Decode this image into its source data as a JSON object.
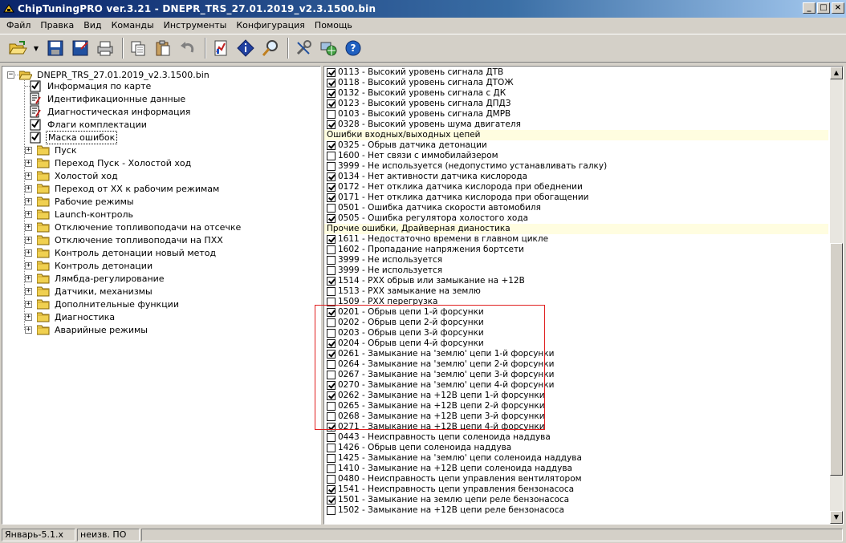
{
  "window": {
    "title": "ChipTuningPRO ver.3.21 - DNEPR_TRS_27.01.2019_v2.3.1500.bin",
    "buttons": {
      "minimize": "_",
      "maximize": "□",
      "close": "×"
    }
  },
  "menu": [
    "Файл",
    "Правка",
    "Вид",
    "Команды",
    "Инструменты",
    "Конфигурация",
    "Помощь"
  ],
  "toolbar": {
    "icons": [
      "open-folder-icon",
      "save-icon",
      "save-as-icon",
      "print-icon",
      "copy-icon",
      "paste-icon",
      "undo-icon",
      "chart-icon",
      "info-icon",
      "search-icon",
      "tools-icon",
      "network-icon",
      "help-icon"
    ]
  },
  "tree": {
    "root": "DNEPR_TRS_27.01.2019_v2.3.1500.bin",
    "docs": [
      {
        "label": "Информация по карте",
        "icon": "checklist"
      },
      {
        "label": "Идентификационные данные",
        "icon": "edit-doc"
      },
      {
        "label": "Диагностическая информация",
        "icon": "edit-doc"
      },
      {
        "label": "Флаги комплектации",
        "icon": "checklist"
      },
      {
        "label": "Маска ошибок",
        "icon": "checklist",
        "selected": true
      }
    ],
    "folders": [
      "Пуск",
      "Переход Пуск - Холостой ход",
      "Холостой ход",
      "Переход от ХХ к рабочим режимам",
      "Рабочие режимы",
      "Launch-контроль",
      "Отключение топливоподачи на отсечке",
      "Отключение топливоподачи на ПХХ",
      "Контроль детонации новый метод",
      "Контроль детонации",
      "Лямбда-регулирование",
      "Датчики, механизмы",
      "Дополнительные функции",
      "Диагностика",
      "Аварийные режимы"
    ]
  },
  "error_list": [
    {
      "text": "0113 - Высокий уровень сигнала ДТВ",
      "checked": true
    },
    {
      "text": "0118 - Высокий уровень сигнала ДТОЖ",
      "checked": true
    },
    {
      "text": "0132 - Высокий уровень сигнала с ДК",
      "checked": true
    },
    {
      "text": "0123 - Высокий уровень сигнала ДПДЗ",
      "checked": true
    },
    {
      "text": "0103 - Высокий уровень сигнала ДМРВ",
      "checked": false
    },
    {
      "text": "0328 - Высокий уровень шума двигателя",
      "checked": true
    },
    {
      "header": "Ошибки входных/выходных цепей"
    },
    {
      "text": "0325 - Обрыв датчика детонации",
      "checked": true
    },
    {
      "text": "1600 - Нет связи с иммобилайзером",
      "checked": false
    },
    {
      "text": "3999 - Не используется (недопустимо устанавливать галку)",
      "checked": false
    },
    {
      "text": "0134 - Нет активности датчика кислорода",
      "checked": true
    },
    {
      "text": "0172 - Нет отклика датчика кислорода при обеднении",
      "checked": true
    },
    {
      "text": "0171 - Нет отклика датчика кислорода при обогащении",
      "checked": true
    },
    {
      "text": "0501 - Ошибка датчика скорости автомобиля",
      "checked": false
    },
    {
      "text": "0505 - Ошибка регулятора холостого хода",
      "checked": true
    },
    {
      "header": "Прочие ошибки, Драйверная дианостика"
    },
    {
      "text": "1611 - Недостаточно времени в главном цикле",
      "checked": true
    },
    {
      "text": "1602 - Пропадание напряжения бортсети",
      "checked": false
    },
    {
      "text": "3999 - Не используется",
      "checked": false
    },
    {
      "text": "3999 - Не используется",
      "checked": false
    },
    {
      "text": "1514 - РХХ обрыв или замыкание на +12В",
      "checked": true
    },
    {
      "text": "1513 - РХХ замыкание на землю",
      "checked": false
    },
    {
      "text": "1509 - РХХ перегрузка",
      "checked": false
    },
    {
      "text": "0201 - Обрыв цепи 1-й форсунки",
      "checked": true
    },
    {
      "text": "0202 - Обрыв цепи 2-й форсунки",
      "checked": false
    },
    {
      "text": "0203 - Обрыв цепи 3-й форсунки",
      "checked": false
    },
    {
      "text": "0204 - Обрыв цепи 4-й форсунки",
      "checked": true
    },
    {
      "text": "0261 - Замыкание на 'землю' цепи 1-й форсунки",
      "checked": true
    },
    {
      "text": "0264 - Замыкание на 'землю' цепи 2-й форсунки",
      "checked": false
    },
    {
      "text": "0267 - Замыкание на 'землю' цепи 3-й форсунки",
      "checked": false
    },
    {
      "text": "0270 - Замыкание на 'землю' цепи 4-й форсунки",
      "checked": true
    },
    {
      "text": "0262 - Замыкание на +12В цепи 1-й форсунки",
      "checked": true
    },
    {
      "text": "0265 - Замыкание на +12В цепи 2-й форсунки",
      "checked": false
    },
    {
      "text": "0268 - Замыкание на +12В цепи 3-й форсунки",
      "checked": false
    },
    {
      "text": "0271 - Замыкание на +12В цепи 4-й форсунки",
      "checked": true
    },
    {
      "text": "0443 - Неисправность цепи соленоида наддува",
      "checked": false
    },
    {
      "text": "1426 - Обрыв цепи соленоида наддува",
      "checked": false
    },
    {
      "text": "1425 - Замыкание на 'землю' цепи соленоида наддува",
      "checked": false
    },
    {
      "text": "1410 - Замыкание на +12В цепи соленоида наддува",
      "checked": false
    },
    {
      "text": "0480 - Неисправность цепи управления вентилятором",
      "checked": false
    },
    {
      "text": "1541 - Неисправность цепи управления бензонасоса",
      "checked": true
    },
    {
      "text": "1501 - Замыкание на землю цепи реле бензонасоса",
      "checked": true
    },
    {
      "text": "1502 - Замыкание на +12В цепи реле бензонасоса",
      "checked": false
    }
  ],
  "statusbar": [
    "Январь-5.1.x",
    "неизв. ПО",
    ""
  ]
}
